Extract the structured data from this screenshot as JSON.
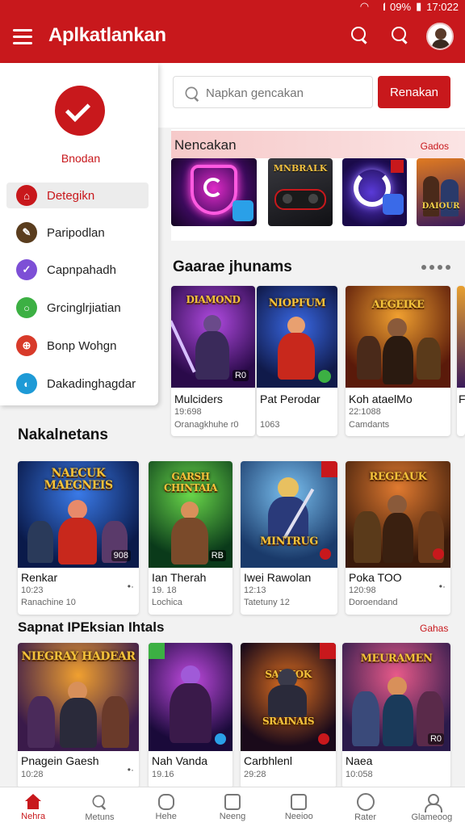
{
  "status_bar": {
    "battery": "09%",
    "time": "17:022"
  },
  "app": {
    "title": "Aplkatlankan",
    "brand_color": "#c8181c",
    "icons": [
      "menu-icon",
      "search-icon",
      "search-icon",
      "avatar"
    ]
  },
  "drawer": {
    "brand": "Bnodan",
    "items": [
      {
        "label": "Detegikn",
        "icon": "tag-icon",
        "color": "#c8181c",
        "active": true
      },
      {
        "label": "Paripodlan",
        "icon": "pen-icon",
        "color": "#5a3d1e",
        "active": false
      },
      {
        "label": "Capnpahadh",
        "icon": "check-icon",
        "color": "#7d4fd6",
        "active": false
      },
      {
        "label": "Grcinglrjiatian",
        "icon": "ring-icon",
        "color": "#3cb043",
        "active": false
      },
      {
        "label": "Bonp Wohgn",
        "icon": "globe-icon",
        "color": "#d83a2a",
        "active": false
      },
      {
        "label": "Dakadinghagdar",
        "icon": "orbit-icon",
        "color": "#1e9ad6",
        "active": false
      }
    ]
  },
  "search": {
    "placeholder": "Napkan gencakan",
    "button": "Renakan"
  },
  "featured": {
    "title": "Nencakan",
    "more": "Gados"
  },
  "sections": {
    "s1": {
      "title": "Gaarae jhunams"
    },
    "s2": {
      "title": "Nakalnetans"
    },
    "s3": {
      "title": "Sapnat IPEksian Ihtals",
      "more": "Gahas"
    }
  },
  "row1": [
    {
      "name": "Mulciders",
      "meta1": "19:698",
      "meta2": "Oranagkhuhe r0",
      "badge": "R0",
      "logo": ""
    },
    {
      "name": "Pat Perodar",
      "meta1": "",
      "meta2": "1063",
      "badge": "",
      "logo": "NIOPFUM"
    },
    {
      "name": "Koh ataelMo",
      "meta1": "22:1088",
      "meta2": "Camdants",
      "badge": "",
      "logo": "AEGEIKE"
    },
    {
      "name": "F",
      "meta1": "",
      "meta2": "",
      "badge": "",
      "logo": ""
    }
  ],
  "row2": [
    {
      "name": "Renkar",
      "meta1": "10:23",
      "meta2": "Ranachine 10",
      "badge": "908",
      "logo": "NAECUK MAEGNEIS"
    },
    {
      "name": "Ian Therah",
      "meta1": "19. 18",
      "meta2": "Lochica",
      "badge": "RB",
      "logo": "GARSH CHINTAIA"
    },
    {
      "name": "Iwei Rawolan",
      "meta1": "12:13",
      "meta2": "Tatetuny 12",
      "badge": "",
      "logo": "MINTRUG"
    },
    {
      "name": "Poka TOO",
      "meta1": "120:98",
      "meta2": "Doroendand",
      "badge": "",
      "logo": "REGEAUK"
    }
  ],
  "row3": [
    {
      "name": "Pnagein Gaesh",
      "meta1": "10:28",
      "meta2": "",
      "logo": "NIEGRAY HADEAR"
    },
    {
      "name": "Nah Vanda",
      "meta1": "19.16",
      "meta2": "",
      "logo": ""
    },
    {
      "name": "Carbhlenl",
      "meta1": "29:28",
      "meta2": "",
      "logo": "SAHKOK SRAINAIS"
    },
    {
      "name": "Naea",
      "meta1": "10:058",
      "meta2": "",
      "logo": "MEURAMEN"
    }
  ],
  "bottom_nav": [
    {
      "label": "Nehra",
      "icon": "home-icon",
      "active": true
    },
    {
      "label": "Metuns",
      "icon": "search-icon",
      "active": false
    },
    {
      "label": "Hehe",
      "icon": "robot-icon",
      "active": false
    },
    {
      "label": "Neeng",
      "icon": "box-icon",
      "active": false
    },
    {
      "label": "Neeioo",
      "icon": "box-icon",
      "active": false
    },
    {
      "label": "Rater",
      "icon": "info-icon",
      "active": false
    },
    {
      "label": "Glameoog",
      "icon": "person-icon",
      "active": false
    }
  ]
}
